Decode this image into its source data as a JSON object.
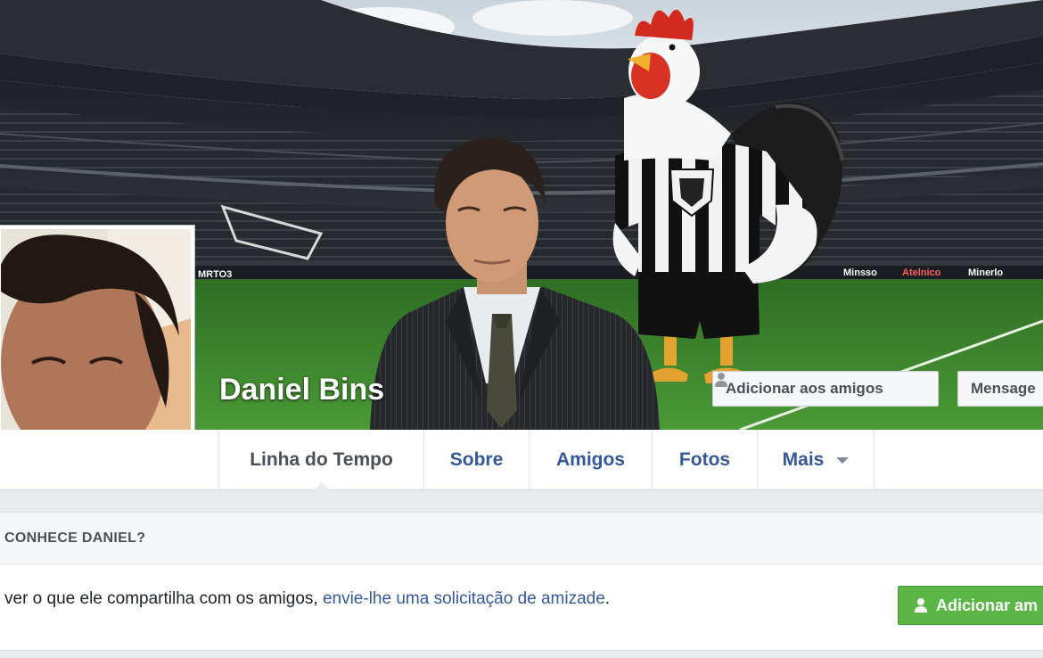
{
  "profile": {
    "name": "Daniel Bins"
  },
  "cover": {
    "add_friend_label": "Adicionar aos amigos",
    "message_label": "Mensage",
    "ad_boards": [
      "MRTO3",
      "Minsso",
      "Atelnico",
      "Minerlo"
    ]
  },
  "tabs": [
    {
      "label": "Linha do Tempo",
      "active": true
    },
    {
      "label": "Sobre"
    },
    {
      "label": "Amigos"
    },
    {
      "label": "Fotos"
    },
    {
      "label": "Mais",
      "has_dropdown": true
    }
  ],
  "know_card": {
    "title": "CONHECE DANIEL?",
    "text_prefix": "ver o que ele compartilha com os amigos,",
    "text_link": "envie-lhe uma solicitação de amizade",
    "text_suffix": ".",
    "button_label": "Adicionar am"
  },
  "icons": {
    "add_friend": "person-add-icon",
    "dropdown": "caret-down-icon"
  },
  "colors": {
    "link": "#365899",
    "green_button": "#5cb646",
    "page_background": "#e9ebee",
    "pitch": "#3f8a2e"
  }
}
